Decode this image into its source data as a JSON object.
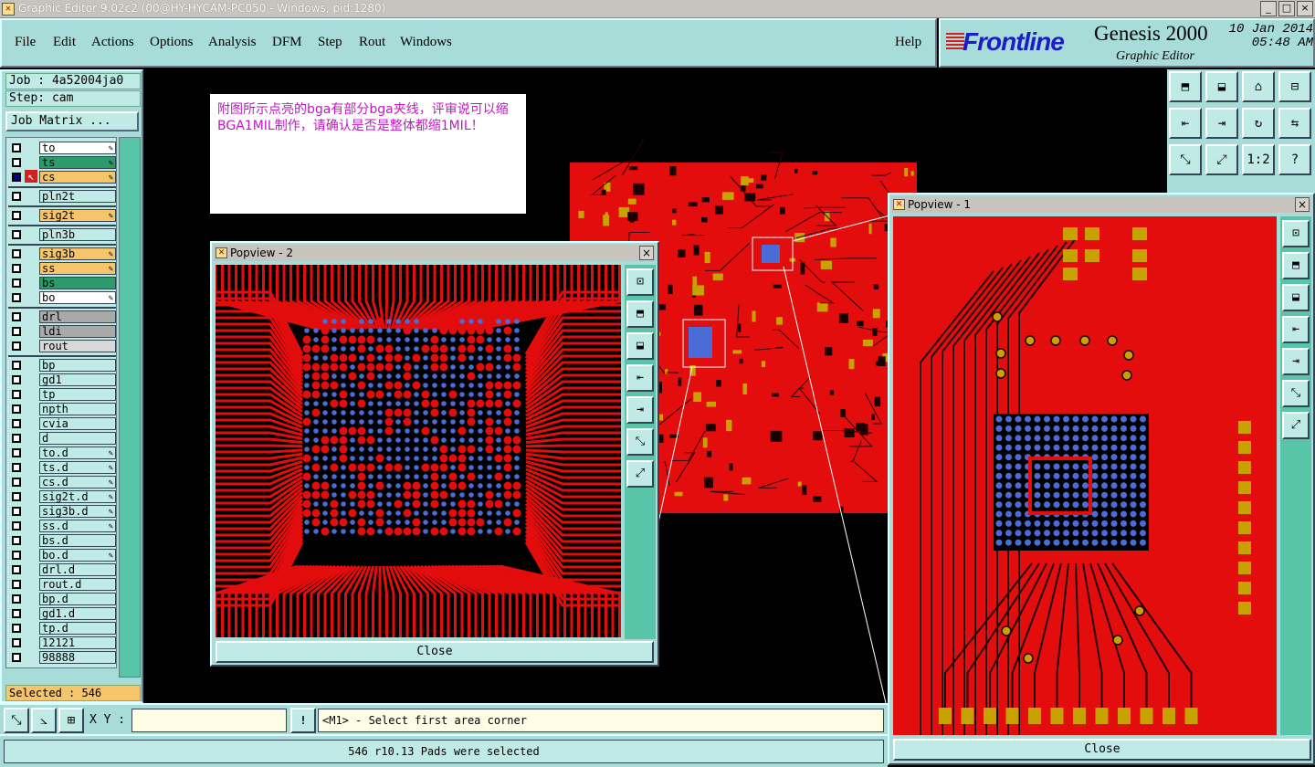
{
  "window": {
    "title": "Graphic Editor 9.02c2 (00@HY-HYCAM-PC050 - Windows, pid:1280)",
    "min": "_",
    "max": "□",
    "close": "×"
  },
  "menu": {
    "items": [
      "File",
      "Edit",
      "Actions",
      "Options",
      "Analysis",
      "DFM",
      "Step",
      "Rout",
      "Windows"
    ],
    "help": "Help"
  },
  "brand": {
    "logo": "Frontline",
    "product": "Genesis 2000",
    "subtitle": "Graphic Editor",
    "date": "10 Jan 2014",
    "time": "05:48 AM"
  },
  "left": {
    "job": "Job : 4a52004ja0",
    "step": "Step: cam",
    "job_matrix": "Job Matrix ..."
  },
  "layers": [
    {
      "name": "to",
      "color": "#ffffff",
      "tool": true,
      "group": 0
    },
    {
      "name": "ts",
      "color": "#2c9a6a",
      "tool": true,
      "group": 0
    },
    {
      "name": "cs",
      "color": "#f6c46a",
      "tool": true,
      "group": 0,
      "active": true
    },
    {
      "name": "pln2t",
      "color": "#bfeae5",
      "tool": false,
      "group": 1
    },
    {
      "name": "sig2t",
      "color": "#f6c46a",
      "tool": true,
      "group": 2
    },
    {
      "name": "pln3b",
      "color": "#bfeae5",
      "tool": false,
      "group": 3
    },
    {
      "name": "sig3b",
      "color": "#f6c46a",
      "tool": true,
      "group": 4
    },
    {
      "name": "ss",
      "color": "#f6c46a",
      "tool": true,
      "group": 4
    },
    {
      "name": "bs",
      "color": "#2c9a6a",
      "tool": false,
      "group": 4
    },
    {
      "name": "bo",
      "color": "#ffffff",
      "tool": true,
      "group": 4
    },
    {
      "name": "drl",
      "color": "#a9aaa8",
      "tool": false,
      "group": 5
    },
    {
      "name": "ldi",
      "color": "#a9aaa8",
      "tool": false,
      "group": 5
    },
    {
      "name": "rout",
      "color": "#d8d8d8",
      "tool": false,
      "group": 5
    },
    {
      "name": "bp",
      "color": "#bfeae5",
      "tool": false,
      "group": 6
    },
    {
      "name": "gd1",
      "color": "#bfeae5",
      "tool": false,
      "group": 6
    },
    {
      "name": "tp",
      "color": "#bfeae5",
      "tool": false,
      "group": 6
    },
    {
      "name": "npth",
      "color": "#bfeae5",
      "tool": false,
      "group": 6
    },
    {
      "name": "cvia",
      "color": "#bfeae5",
      "tool": false,
      "group": 6
    },
    {
      "name": "d",
      "color": "#bfeae5",
      "tool": false,
      "group": 6
    },
    {
      "name": "to.d",
      "color": "#bfeae5",
      "tool": true,
      "group": 6
    },
    {
      "name": "ts.d",
      "color": "#bfeae5",
      "tool": true,
      "group": 6
    },
    {
      "name": "cs.d",
      "color": "#bfeae5",
      "tool": true,
      "group": 6
    },
    {
      "name": "sig2t.d",
      "color": "#bfeae5",
      "tool": true,
      "group": 6
    },
    {
      "name": "sig3b.d",
      "color": "#bfeae5",
      "tool": true,
      "group": 6
    },
    {
      "name": "ss.d",
      "color": "#bfeae5",
      "tool": true,
      "group": 6
    },
    {
      "name": "bs.d",
      "color": "#bfeae5",
      "tool": false,
      "group": 6
    },
    {
      "name": "bo.d",
      "color": "#bfeae5",
      "tool": true,
      "group": 6
    },
    {
      "name": "drl.d",
      "color": "#bfeae5",
      "tool": false,
      "group": 6
    },
    {
      "name": "rout.d",
      "color": "#bfeae5",
      "tool": false,
      "group": 6
    },
    {
      "name": "bp.d",
      "color": "#bfeae5",
      "tool": false,
      "group": 6
    },
    {
      "name": "gd1.d",
      "color": "#bfeae5",
      "tool": false,
      "group": 6
    },
    {
      "name": "tp.d",
      "color": "#bfeae5",
      "tool": false,
      "group": 6
    },
    {
      "name": "12121",
      "color": "#bfeae5",
      "tool": false,
      "group": 6
    },
    {
      "name": "98888",
      "color": "#bfeae5",
      "tool": false,
      "group": 6
    }
  ],
  "selected": "Selected : 546",
  "note": "附图所示点亮的bga有部分bga夹线，评审说可以缩BGA1MIL制作，请确认是否是整体都缩1MIL！",
  "popview2": {
    "title": "Popview - 2",
    "close": "Close"
  },
  "popview1": {
    "title": "Popview - 1",
    "close": "Close"
  },
  "toolbar_buttons": [
    "⬒",
    "⬓",
    "⌂",
    "⊟",
    "⇤",
    "⇥",
    "↻",
    "⇆",
    "⤡",
    "⤢",
    "1:2",
    "?"
  ],
  "popview_tools": [
    "⊡",
    "⬒",
    "⬓",
    "⇤",
    "⇥",
    "⤡",
    "⤢"
  ],
  "cmd": {
    "xy_label": "X Y :",
    "xy_value": "",
    "bang": "!",
    "prompt": "<M1> - Select first area corner"
  },
  "status": "546 r10.13 Pads were selected",
  "colors": {
    "board": "#e30d0d",
    "pad": "#4b6cd6",
    "copper_pad": "#c8a200",
    "accent": "#a7dcd8"
  }
}
